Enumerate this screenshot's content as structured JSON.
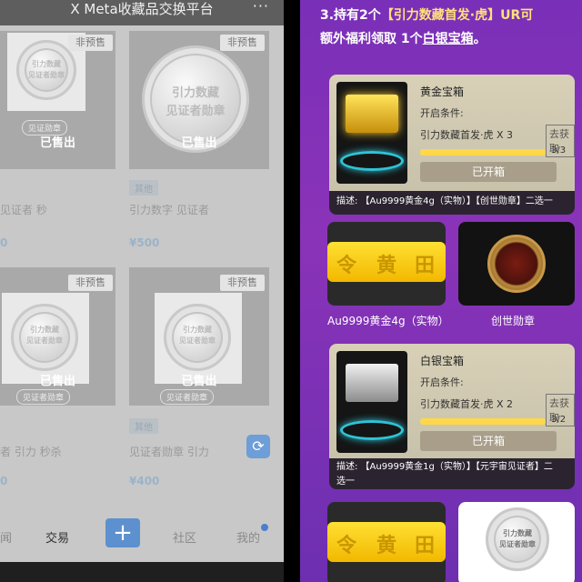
{
  "left": {
    "header": {
      "title": "X Meta收藏品交换平台",
      "more": "···"
    },
    "cards": [
      {
        "presale": "非预售",
        "coin_line1": "引力数藏",
        "coin_line2": "见证者勋章",
        "sold": "已售出",
        "pill": "见证勋章",
        "tag": "",
        "name": "见证者 秒",
        "price": "0"
      },
      {
        "presale": "非预售",
        "coin_line1": "引力数藏",
        "coin_line2": "见证者勋章",
        "sold": "已售出",
        "pill": "",
        "tag": "其他",
        "name": "引力数字 见证者",
        "price": "¥500"
      },
      {
        "presale": "非预售",
        "coin_line1": "引力数藏",
        "coin_line2": "见证者勋章",
        "sold": "已售出",
        "pill": "见证者勋章",
        "tag": "",
        "name": "者 引力 秒杀",
        "price": "0"
      },
      {
        "presale": "非预售",
        "coin_line1": "引力数藏",
        "coin_line2": "见证者勋章",
        "sold": "已售出",
        "pill": "见证者勋章",
        "tag": "其他",
        "name": "见证者勋章 引力",
        "price": "¥400"
      }
    ],
    "nav": {
      "item1": "闻",
      "item2": "交易",
      "plus": "+",
      "item4": "社区",
      "item5": "我的"
    },
    "swap_icon": "⟳"
  },
  "right": {
    "promo_pre": "3.持有2个",
    "promo_hl": "【引力数藏首发·虎】UR可",
    "promo_line2_pre": "额外福利领取 1个",
    "promo_link": "白银宝箱",
    "promo_end": "。",
    "boxes": [
      {
        "name": "黄金宝箱",
        "cond": "开启条件:",
        "req": "引力数藏首发·虎 X 3",
        "get": "去获取",
        "progress": "3/3",
        "opened": "已开箱",
        "desc": "描述: 【Au9999黄金4g（实物）】【创世勋章】二选一",
        "fill": 1.0
      },
      {
        "name": "白银宝箱",
        "cond": "开启条件:",
        "req": "引力数藏首发·虎 X 2",
        "get": "去获取",
        "progress": "3/2",
        "opened": "已开箱",
        "desc1": "描述: 【Au9999黄金1g（实物）】【元宇宙见证者】二",
        "desc2": "选一",
        "fill": 1.0
      }
    ],
    "rewards": {
      "gold_label": "Au9999黄金4g（实物）",
      "medal_label": "创世勋章",
      "gold_glyphs": [
        "令",
        "黄",
        "田"
      ]
    },
    "coin2": {
      "line1": "引力数藏",
      "line2": "见证者勋章"
    }
  },
  "colors": {
    "left_bg": "#c8c8c8",
    "right_bg": "#7a2fb8",
    "accent": "#5d90cf",
    "gold": "#ffd84a"
  }
}
